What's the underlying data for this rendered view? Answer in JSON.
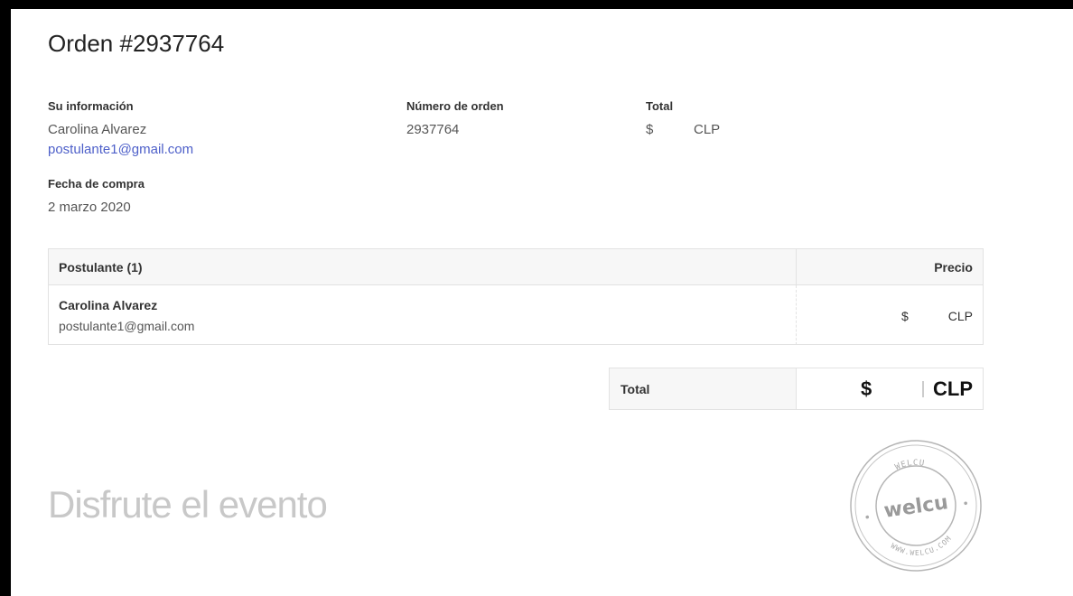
{
  "order": {
    "title": "Orden #2937764"
  },
  "info": {
    "label": "Su información",
    "name": "Carolina Alvarez",
    "email": "postulante1@gmail.com"
  },
  "order_number": {
    "label": "Número de orden",
    "value": "2937764"
  },
  "total_summary": {
    "label": "Total",
    "currency_symbol": "$",
    "currency": "CLP"
  },
  "purchase_date": {
    "label": "Fecha de compra",
    "value": "2 marzo 2020"
  },
  "table": {
    "header_attendee": "Postulante (1)",
    "header_price": "Precio",
    "rows": [
      {
        "name": "Carolina Alvarez",
        "email": "postulante1@gmail.com",
        "currency_symbol": "$",
        "currency": "CLP"
      }
    ]
  },
  "grand_total": {
    "label": "Total",
    "currency_symbol": "$",
    "currency": "CLP"
  },
  "footer": {
    "message": "Disfrute el evento"
  },
  "stamp": {
    "top_text": "WELCU",
    "center_text": "welcu",
    "bottom_text": "WWW.WELCU.COM"
  },
  "colors": {
    "link": "#4d5fc9",
    "table_header_bg": "#f7f7f7",
    "border": "#e2e2e2",
    "muted": "#c8c8c8"
  }
}
